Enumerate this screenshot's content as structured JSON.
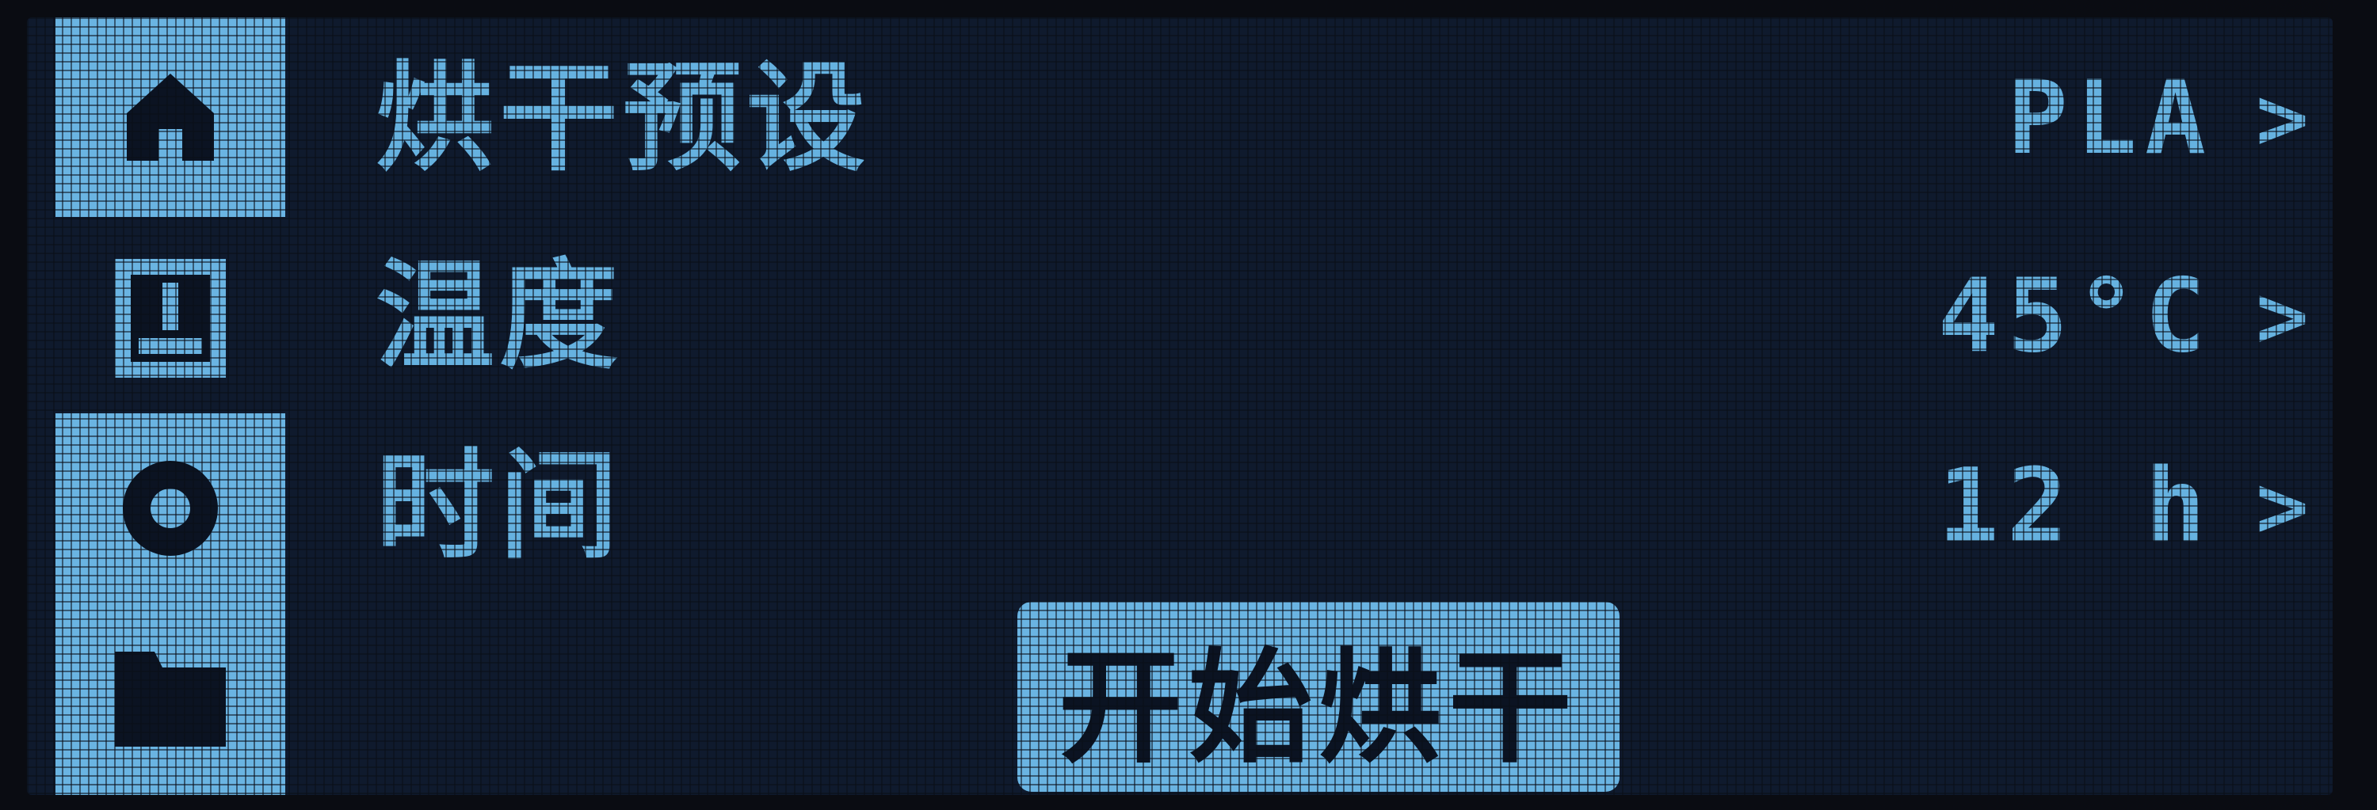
{
  "colors": {
    "background": "#0f1a2d",
    "accent": "#6ab4e2",
    "text_on_accent": "#0b1322"
  },
  "sidebar": {
    "items": [
      {
        "icon": "home-icon",
        "state": "active"
      },
      {
        "icon": "display-icon",
        "state": "inactive"
      },
      {
        "icon": "settings-icon",
        "state": "highlighted"
      },
      {
        "icon": "folder-icon",
        "state": "highlighted"
      }
    ]
  },
  "menu": {
    "rows": [
      {
        "label": "烘干预设",
        "value": "PLA",
        "chevron": ">"
      },
      {
        "label": "温度",
        "value": "45°C",
        "chevron": ">"
      },
      {
        "label": "时间",
        "value": "12 h",
        "chevron": ">"
      }
    ]
  },
  "start_button": {
    "label": "开始烘干"
  }
}
